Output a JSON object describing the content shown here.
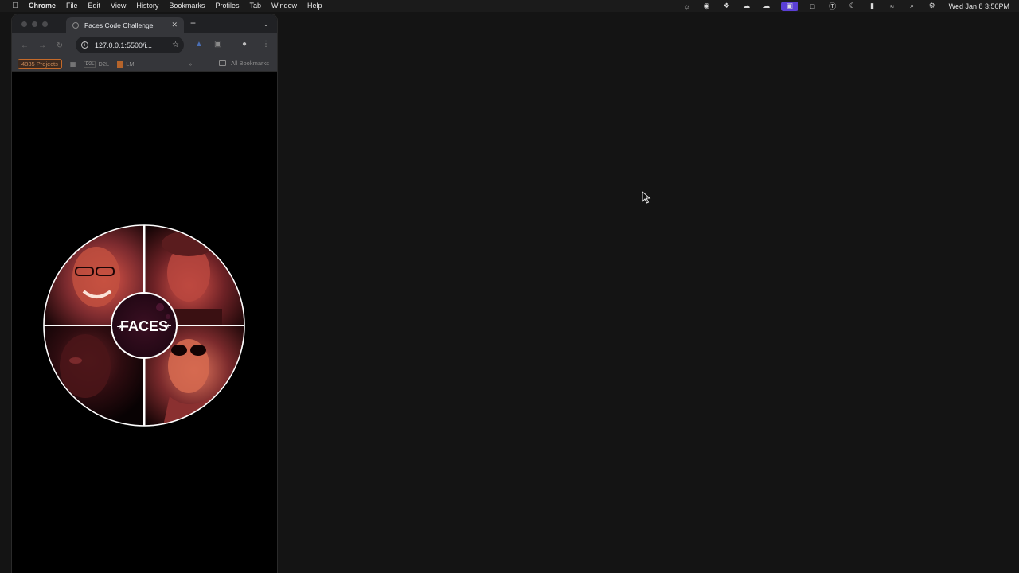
{
  "menubar": {
    "app_name": "Chrome",
    "items": [
      "File",
      "Edit",
      "View",
      "History",
      "Bookmarks",
      "Profiles",
      "Tab",
      "Window",
      "Help"
    ],
    "clock": "Wed Jan 8  3:50PM",
    "status_icons": [
      "brightness-icon",
      "creative-cloud-icon",
      "dropbox-icon",
      "cloud-sync-icon",
      "cloud-sync-2-icon",
      "screen-mirror-icon",
      "window-icon",
      "password-manager-icon",
      "focus-moon-icon",
      "battery-icon",
      "wifi-icon",
      "search-icon",
      "control-center-icon"
    ]
  },
  "browser": {
    "tab_title": "Faces Code Challenge",
    "url": "127.0.0.1:5500/i...",
    "bookmarks": {
      "projects_label": "4835 Projects",
      "d2l_icon_text": "D2L",
      "d2l_label": "D2L",
      "lm_label": "LM",
      "overflow": "»",
      "all_label": "All Bookmarks"
    }
  },
  "page": {
    "logo_text": "FACES",
    "accent_color": "#e0584a",
    "center_color": "#2c0a18"
  }
}
